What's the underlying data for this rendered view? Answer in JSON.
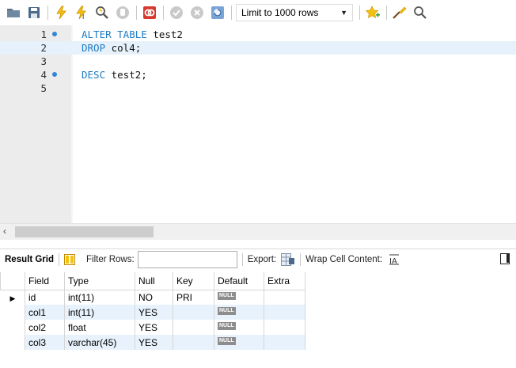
{
  "toolbar": {
    "limit_label": "Limit to 1000 rows",
    "icons": [
      "open-folder-icon",
      "save-icon",
      "execute-icon",
      "execute-current-icon",
      "explain-icon",
      "stop-icon",
      "toggle-continue-icon",
      "commit-icon",
      "rollback-icon",
      "autocommit-icon",
      "beautify-icon",
      "find-icon"
    ]
  },
  "editor": {
    "lines": [
      {
        "num": "1",
        "marker": true,
        "code_kw": "ALTER TABLE",
        "code_rest": " test2"
      },
      {
        "num": "2",
        "marker": false,
        "code_kw": "DROP",
        "code_rest": " col4;"
      },
      {
        "num": "3",
        "marker": false,
        "code_kw": "",
        "code_rest": ""
      },
      {
        "num": "4",
        "marker": true,
        "code_kw": "DESC",
        "code_rest": " test2;"
      },
      {
        "num": "5",
        "marker": false,
        "code_kw": "",
        "code_rest": ""
      }
    ]
  },
  "result": {
    "result_grid_label": "Result Grid",
    "filter_label": "Filter Rows:",
    "export_label": "Export:",
    "wrap_label": "Wrap Cell Content:",
    "columns": [
      "Field",
      "Type",
      "Null",
      "Key",
      "Default",
      "Extra"
    ],
    "null_badge": "NULL",
    "rows": [
      {
        "field": "id",
        "type": "int(11)",
        "null": "NO",
        "key": "PRI",
        "default": "NULL",
        "extra": ""
      },
      {
        "field": "col1",
        "type": "int(11)",
        "null": "YES",
        "key": "",
        "default": "NULL",
        "extra": ""
      },
      {
        "field": "col2",
        "type": "float",
        "null": "YES",
        "key": "",
        "default": "NULL",
        "extra": ""
      },
      {
        "field": "col3",
        "type": "varchar(45)",
        "null": "YES",
        "key": "",
        "default": "NULL",
        "extra": ""
      }
    ]
  },
  "colors": {
    "keyword": "#1d7bc4",
    "active_line": "#e6f1fb",
    "alt_row": "#e8f2fc",
    "marker_dot": "#2f86d6",
    "null_badge": "#8d8d8d"
  }
}
